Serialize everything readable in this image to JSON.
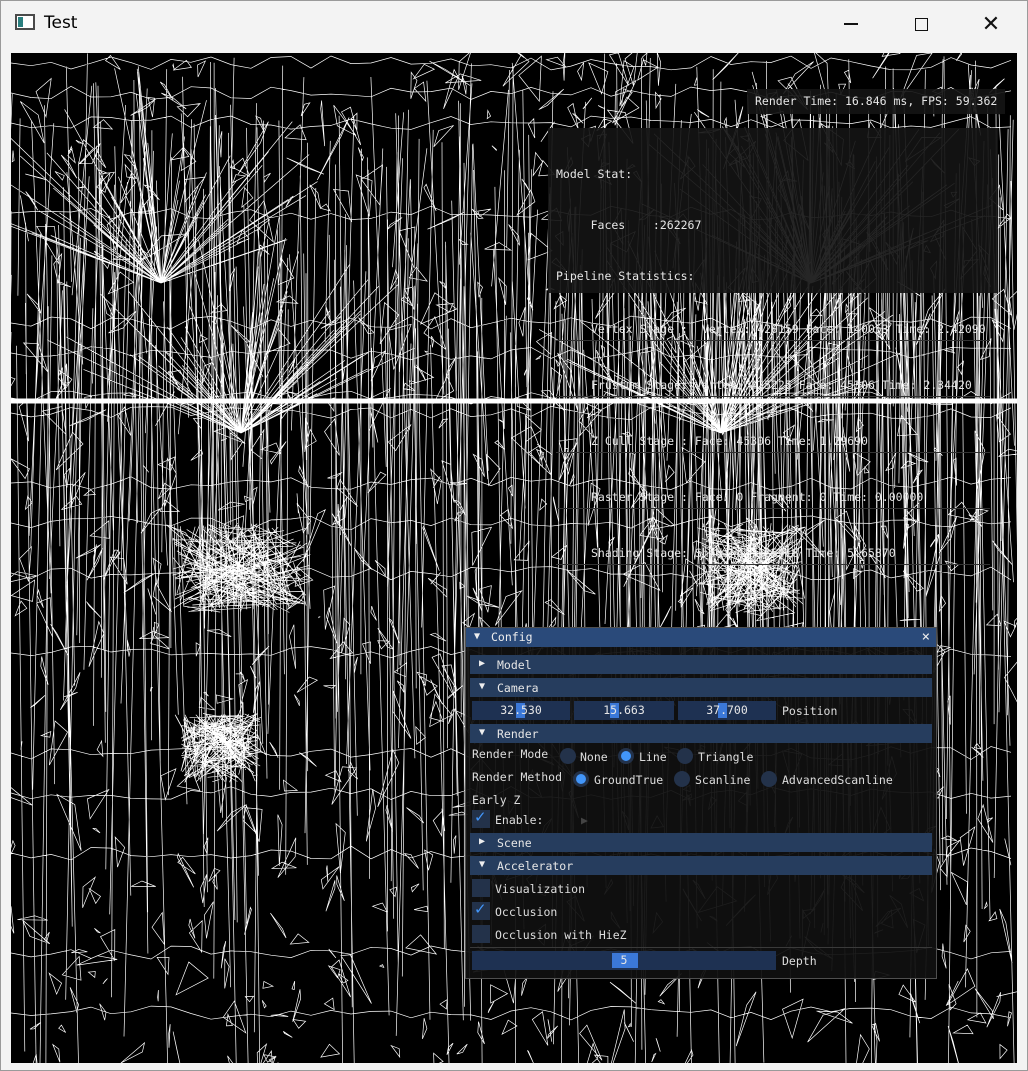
{
  "window": {
    "title": "Test"
  },
  "overlay": {
    "render_time": "Render Time: 16.846 ms, FPS: 59.362",
    "model_stat": "Model Stat:",
    "faces": "     Faces    :262267",
    "pipeline": "Pipeline Statistics:",
    "stages": [
      "Vertex Stage :  Vertex: 420159 Face: 140053 Time: 2.42090",
      "Frustum Stage: Vertex: 425225 Face: 45306 Time: 2.34420",
      "Z Cull Stage : Face: 45306 Time: 1.29690",
      "Raster Stage : Face: 0 Fragment: 0 Time: 0.00000",
      "Shading Stage: Shading: 135918 Time: 5.65870"
    ]
  },
  "config": {
    "title": "Config",
    "close": "×",
    "sections": {
      "model": "Model",
      "camera": "Camera",
      "render": "Render",
      "scene": "Scene",
      "accelerator": "Accelerator"
    },
    "camera": {
      "x": "32.530",
      "y": "15.663",
      "z": "37.700",
      "label": "Position"
    },
    "render": {
      "mode_label": "Render Mode",
      "mode_options": [
        "None",
        "Line",
        "Triangle"
      ],
      "mode_selected": "Line",
      "method_label": "Render Method",
      "method_options": [
        "GroundTrue",
        "Scanline",
        "AdvancedScanline"
      ],
      "method_selected": "GroundTrue",
      "early_z_label": "Early Z",
      "enable_label": "Enable:",
      "enable_checked": true
    },
    "accelerator": {
      "visualization": "Visualization",
      "visualization_checked": false,
      "occlusion": "Occlusion",
      "occlusion_checked": true,
      "occlusion_hiez": "Occlusion with HieZ",
      "occlusion_hiez_checked": false,
      "depth_value": "5",
      "depth_label": "Depth"
    }
  },
  "colors": {
    "wireframe": "#ffffff",
    "background": "#000000",
    "title_bar": "#2a4a7a",
    "header": "#263d5e",
    "accent": "#4296fa"
  }
}
